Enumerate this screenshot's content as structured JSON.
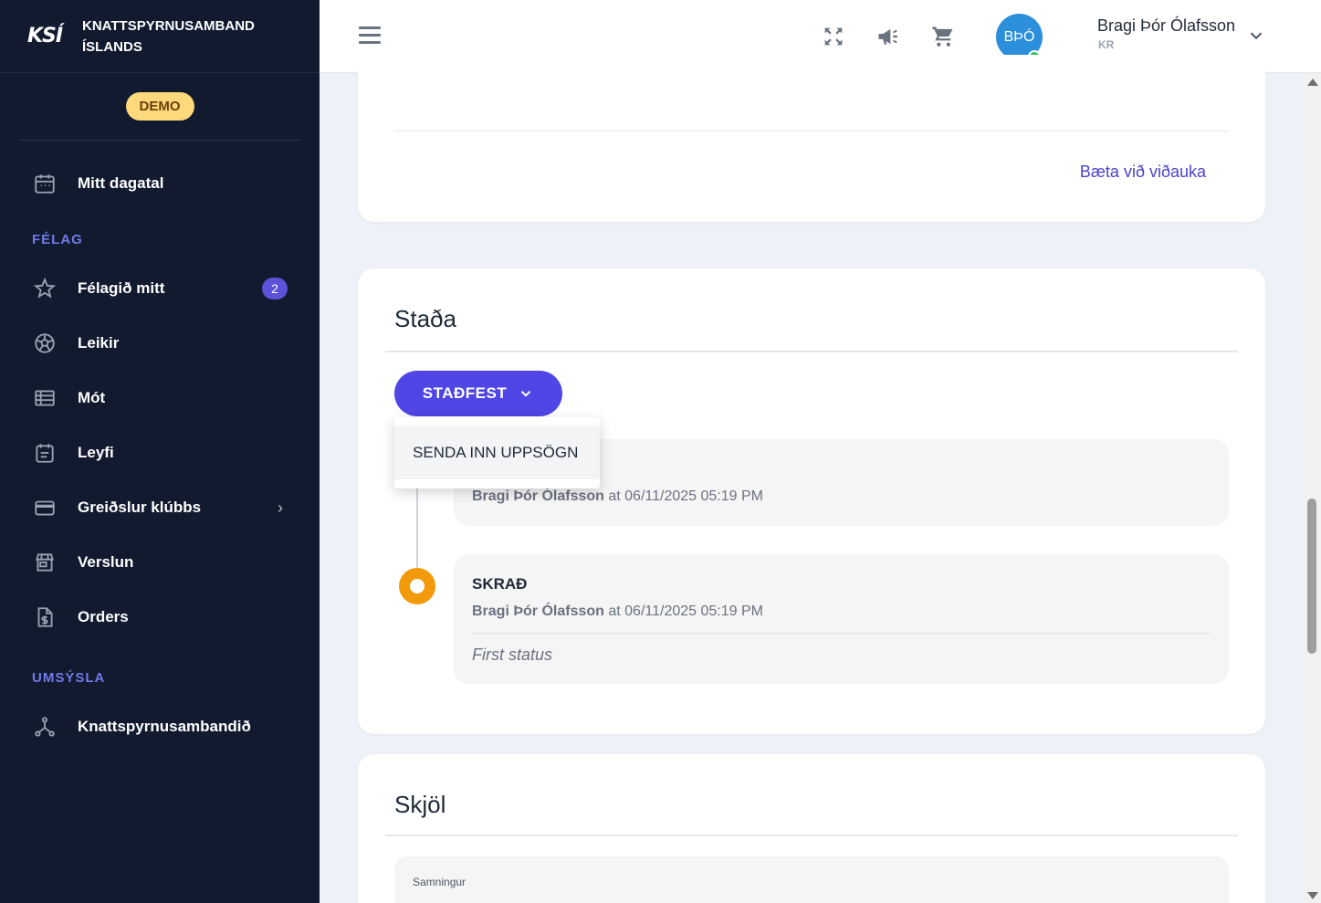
{
  "brand": {
    "logo": "KSÍ",
    "name_line1": "KNATTSPYRNUSAMBAND",
    "name_line2": "ÍSLANDS"
  },
  "demo_label": "DEMO",
  "sidebar": {
    "items": [
      {
        "label": "Mitt dagatal"
      },
      {
        "label": "Félagið mitt",
        "badge": "2"
      },
      {
        "label": "Leikir"
      },
      {
        "label": "Mót"
      },
      {
        "label": "Leyfi"
      },
      {
        "label": "Greiðslur klúbbs",
        "chevron": "›"
      },
      {
        "label": "Verslun"
      },
      {
        "label": "Orders"
      },
      {
        "label": "Knattspyrnusambandið"
      }
    ],
    "sections": [
      "FÉLAG",
      "UMSÝSLA"
    ]
  },
  "topbar": {
    "avatar_initials": "BÞÓ",
    "user_name": "Bragi Þór Ólafsson",
    "user_club": "KR"
  },
  "main": {
    "add_attachment": "Bæta við viðauka",
    "status_section": {
      "title": "Staða",
      "button_label": "STAÐFEST",
      "dropdown_option": "SENDA INN UPPSÖGN",
      "entries": [
        {
          "title": "",
          "author": "Bragi Þór Ólafsson",
          "time": " at 06/11/2025 05:19 PM"
        },
        {
          "title": "SKRAÐ",
          "author": "Bragi Þór Ólafsson",
          "time": " at 06/11/2025 05:19 PM",
          "note": "First status"
        }
      ]
    },
    "documents_section": {
      "title": "Skjöl",
      "doc_label": "Samningur"
    }
  },
  "colors": {
    "sidebar_bg": "#111a2e",
    "accent": "#4f46e5",
    "timeline_dot": "#f39a0b",
    "section_label": "#6f7be8"
  }
}
